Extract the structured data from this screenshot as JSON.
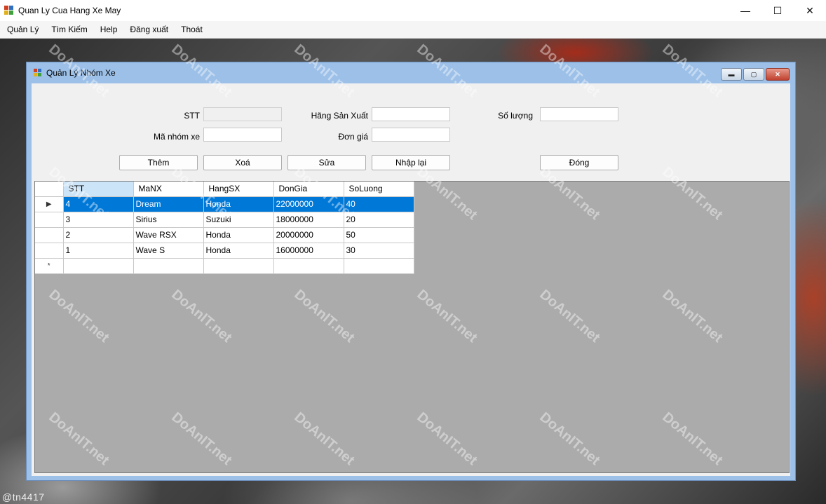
{
  "window": {
    "title": "Quan Ly Cua Hang Xe May",
    "minimize": "—",
    "maximize": "☐",
    "close": "✕"
  },
  "menu": [
    "Quản Lý",
    "Tìm Kiếm",
    "Help",
    "Đăng xuất",
    "Thoát"
  ],
  "background": {
    "credit": "@tn4417",
    "watermark": "DoAnIT.net"
  },
  "child": {
    "title": "Quản Lý Nhóm Xe",
    "minimize": "▬",
    "maximize": "▢",
    "close": "✕"
  },
  "form": {
    "stt_label": "STT",
    "stt_value": "",
    "manhom_label": "Mã nhóm xe",
    "manhom_value": "",
    "hang_label": "Hãng Sản Xuất",
    "hang_value": "",
    "dongia_label": "Đơn giá",
    "dongia_value": "",
    "soluong_label": "Số lượng",
    "soluong_value": ""
  },
  "buttons": {
    "them": "Thêm",
    "xoa": "Xoá",
    "sua": "Sửa",
    "nhaplai": "Nhập lại",
    "dong": "Đóng"
  },
  "grid": {
    "columns": [
      "STT",
      "MaNX",
      "HangSX",
      "DonGia",
      "SoLuong"
    ],
    "rows": [
      [
        "4",
        "Dream",
        "Honda",
        "22000000",
        "40"
      ],
      [
        "3",
        "Sirius",
        "Suzuki",
        "18000000",
        "20"
      ],
      [
        "2",
        "Wave RSX",
        "Honda",
        "20000000",
        "50"
      ],
      [
        "1",
        "Wave S",
        "Honda",
        "16000000",
        "30"
      ]
    ],
    "current_row_marker": "▶",
    "new_row_marker": "*"
  },
  "colors": {
    "selection": "#0078d7",
    "header_selected": "#cce4f7",
    "grid_bg": "#ababab",
    "child_frame": "#9cc0e8"
  }
}
